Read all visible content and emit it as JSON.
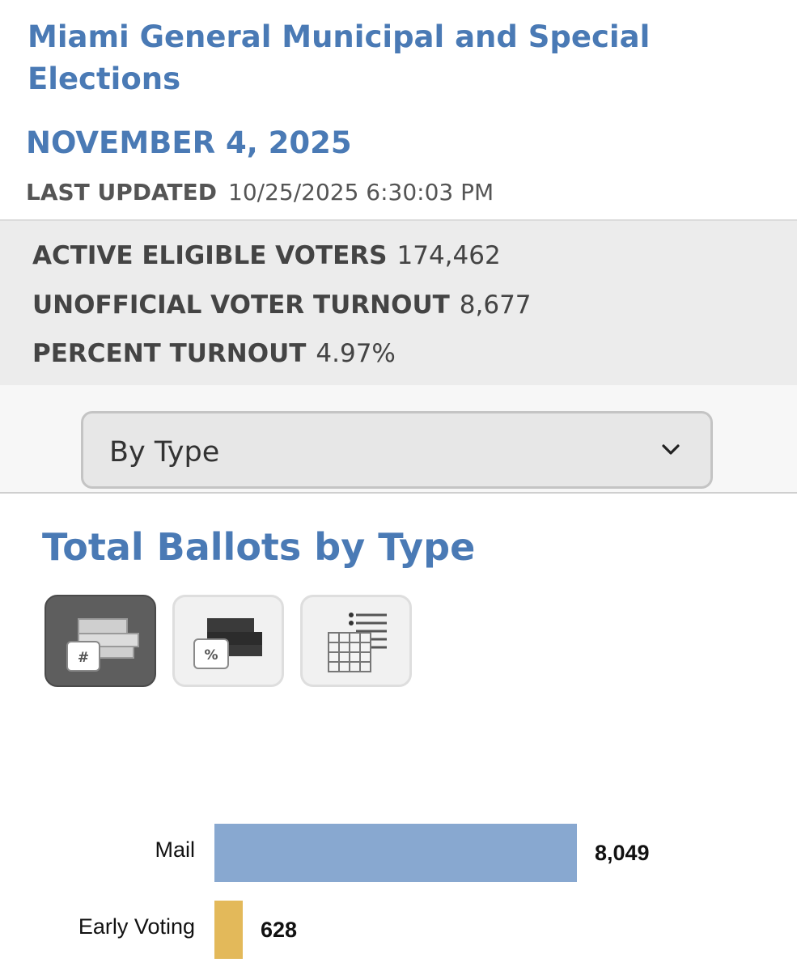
{
  "header": {
    "title": "Miami General Municipal and Special Elections",
    "date": "NOVEMBER 4, 2025",
    "last_updated_label": "LAST UPDATED",
    "last_updated_value": "10/25/2025 6:30:03 PM"
  },
  "stats": {
    "active_label": "ACTIVE ELIGIBLE VOTERS",
    "active_value": "174,462",
    "turnout_label": "UNOFFICIAL VOTER TURNOUT",
    "turnout_value": "8,677",
    "percent_label": "PERCENT TURNOUT",
    "percent_value": "4.97%"
  },
  "view_select": {
    "selected": "By Type"
  },
  "section": {
    "title": "Total Ballots by Type"
  },
  "view_buttons": [
    {
      "icon": "bar-chart-count-icon",
      "active": true
    },
    {
      "icon": "bar-chart-percent-icon",
      "active": false
    },
    {
      "icon": "table-view-icon",
      "active": false
    }
  ],
  "colors": {
    "accent": "#4a7ab5",
    "mail_bar": "#88a8d0",
    "early_bar": "#e3b95a"
  },
  "chart_data": {
    "type": "bar",
    "orientation": "horizontal",
    "categories": [
      "Mail",
      "Early Voting"
    ],
    "values": [
      8049,
      628
    ],
    "value_labels": [
      "8,049",
      "628"
    ],
    "colors": [
      "#88a8d0",
      "#e3b95a"
    ],
    "title": "",
    "xlabel": "",
    "ylabel": "",
    "grid": false
  }
}
